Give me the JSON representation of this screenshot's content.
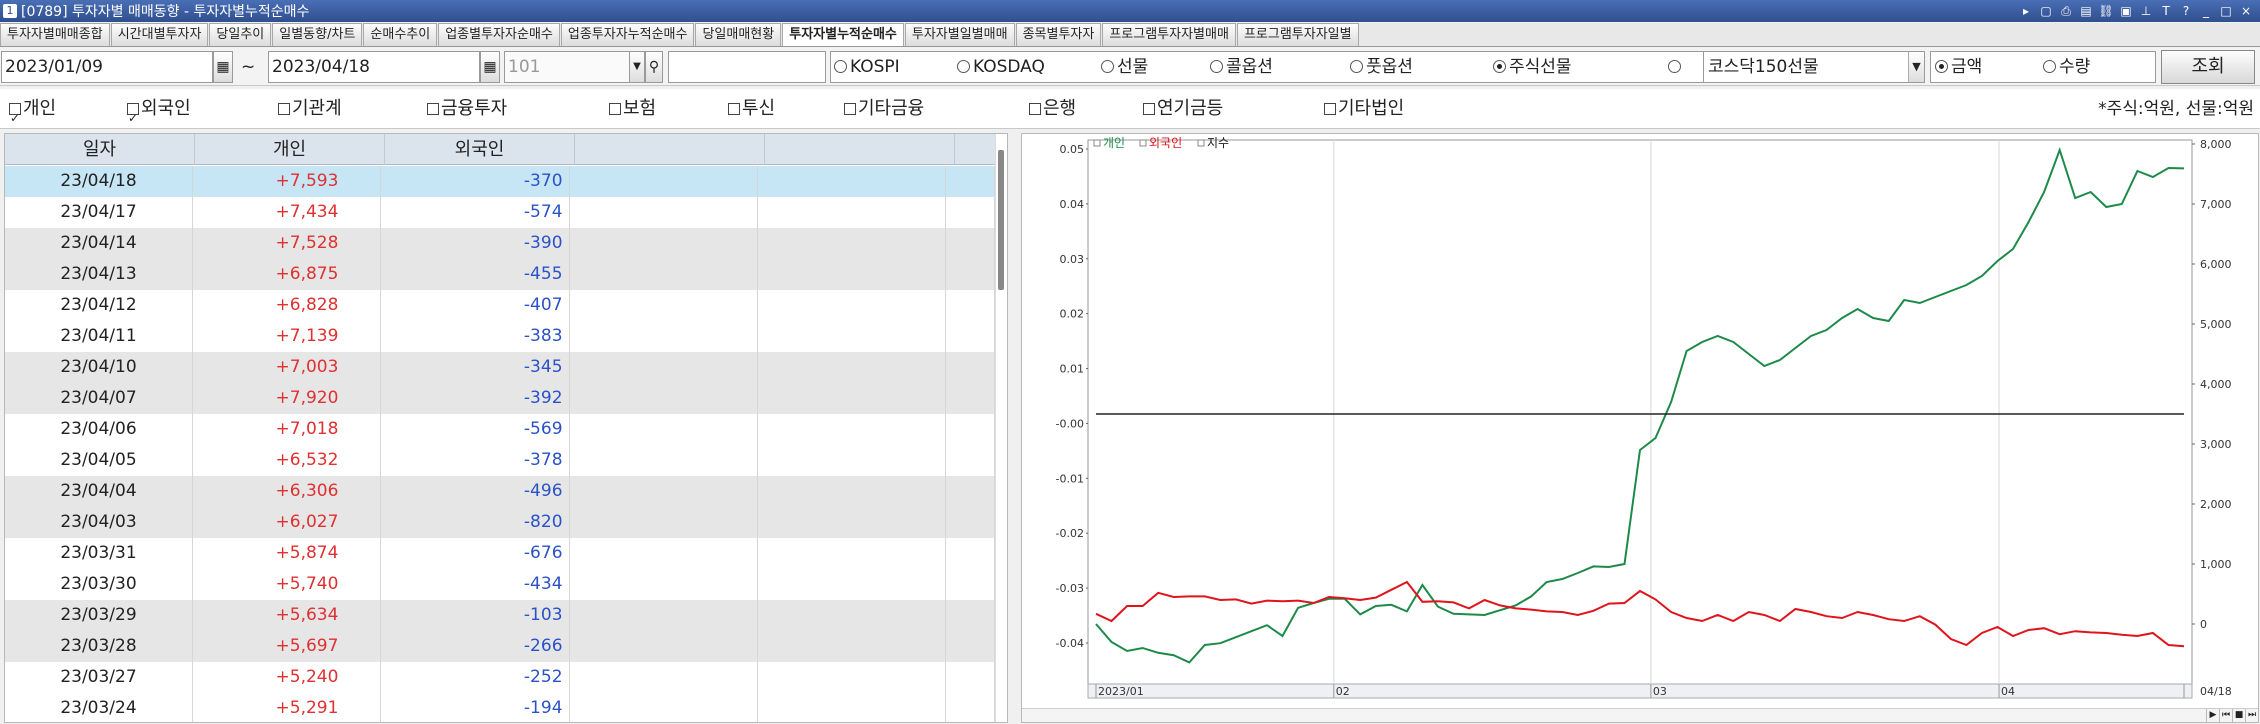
{
  "window": {
    "title": "[0789] 투자자별 매매동향 - 투자자별누적순매수",
    "icon_label": "1"
  },
  "tabs": [
    {
      "label": "투자자별매매종합",
      "active": false
    },
    {
      "label": "시간대별투자자",
      "active": false
    },
    {
      "label": "당일추이",
      "active": false
    },
    {
      "label": "일별동향/차트",
      "active": false
    },
    {
      "label": "순매수추이",
      "active": false
    },
    {
      "label": "업종별투자자순매수",
      "active": false
    },
    {
      "label": "업종투자자누적순매수",
      "active": false
    },
    {
      "label": "당일매매현황",
      "active": false
    },
    {
      "label": "투자자별누적순매수",
      "active": true
    },
    {
      "label": "투자자별일별매매",
      "active": false
    },
    {
      "label": "종목별투자자",
      "active": false
    },
    {
      "label": "프로그램투자자별매매",
      "active": false
    },
    {
      "label": "프로그램투자자일별",
      "active": false
    }
  ],
  "filters": {
    "start_date": "2023/01/09",
    "tilde": "~",
    "end_date": "2023/04/18",
    "code": "101",
    "markets": [
      {
        "label": "KOSPI",
        "checked": false
      },
      {
        "label": "KOSDAQ",
        "checked": false
      },
      {
        "label": "선물",
        "checked": false
      },
      {
        "label": "콜옵션",
        "checked": false
      },
      {
        "label": "풋옵션",
        "checked": false
      },
      {
        "label": "주식선물",
        "checked": true
      },
      {
        "label": "",
        "checked": false
      }
    ],
    "futures_select": "코스닥150선물",
    "units": [
      {
        "label": "금액",
        "checked": true
      },
      {
        "label": "수량",
        "checked": false
      }
    ],
    "query_button": "조회"
  },
  "investors": [
    {
      "label": "개인",
      "checked": true
    },
    {
      "label": "외국인",
      "checked": true
    },
    {
      "label": "기관계",
      "checked": false
    },
    {
      "label": "금융투자",
      "checked": false
    },
    {
      "label": "보험",
      "checked": false
    },
    {
      "label": "투신",
      "checked": false
    },
    {
      "label": "기타금융",
      "checked": false
    },
    {
      "label": "은행",
      "checked": false
    },
    {
      "label": "연기금등",
      "checked": false
    },
    {
      "label": "기타법인",
      "checked": false
    }
  ],
  "unit_note": "*주식:억원, 선물:억원",
  "grid": {
    "headers": [
      "일자",
      "개인",
      "외국인",
      "",
      "",
      ""
    ],
    "rows": [
      {
        "date": "23/04/18",
        "individual": "+7,593",
        "foreign": "-370"
      },
      {
        "date": "23/04/17",
        "individual": "+7,434",
        "foreign": "-574"
      },
      {
        "date": "23/04/14",
        "individual": "+7,528",
        "foreign": "-390"
      },
      {
        "date": "23/04/13",
        "individual": "+6,875",
        "foreign": "-455"
      },
      {
        "date": "23/04/12",
        "individual": "+6,828",
        "foreign": "-407"
      },
      {
        "date": "23/04/11",
        "individual": "+7,139",
        "foreign": "-383"
      },
      {
        "date": "23/04/10",
        "individual": "+7,003",
        "foreign": "-345"
      },
      {
        "date": "23/04/07",
        "individual": "+7,920",
        "foreign": "-392"
      },
      {
        "date": "23/04/06",
        "individual": "+7,018",
        "foreign": "-569"
      },
      {
        "date": "23/04/05",
        "individual": "+6,532",
        "foreign": "-378"
      },
      {
        "date": "23/04/04",
        "individual": "+6,306",
        "foreign": "-496"
      },
      {
        "date": "23/04/03",
        "individual": "+6,027",
        "foreign": "-820"
      },
      {
        "date": "23/03/31",
        "individual": "+5,874",
        "foreign": "-676"
      },
      {
        "date": "23/03/30",
        "individual": "+5,740",
        "foreign": "-434"
      },
      {
        "date": "23/03/29",
        "individual": "+5,634",
        "foreign": "-103"
      },
      {
        "date": "23/03/28",
        "individual": "+5,697",
        "foreign": "-266"
      },
      {
        "date": "23/03/27",
        "individual": "+5,240",
        "foreign": "-252"
      },
      {
        "date": "23/03/24",
        "individual": "+5,291",
        "foreign": "-194"
      }
    ]
  },
  "chart_data": {
    "type": "line",
    "legend": [
      "개인",
      "외국인",
      "지수"
    ],
    "colors": {
      "개인": "#1e8a4a",
      "외국인": "#e0141c",
      "지수": "#222222"
    },
    "left_axis": {
      "ticks": [
        "0.05",
        "0.04",
        "0.03",
        "0.02",
        "0.01",
        "-0.00",
        "-0.01",
        "-0.02",
        "-0.03",
        "-0.04"
      ],
      "range": [
        -0.045,
        0.05
      ]
    },
    "right_axis": {
      "ticks": [
        "8,000",
        "7,000",
        "6,000",
        "5,000",
        "4,000",
        "3,000",
        "2,000",
        "1,000",
        "0"
      ],
      "range": [
        -1000,
        8000
      ]
    },
    "x_labels": [
      "2023/01",
      "02",
      "03",
      "04",
      "04/18"
    ],
    "x_label_positions": [
      0,
      15.3,
      35.7,
      58.1,
      70
    ],
    "n_points": 71,
    "series": [
      {
        "name": "개인",
        "values": [
          0,
          -300,
          -450,
          -400,
          -480,
          -520,
          -640,
          -350,
          -320,
          -220,
          -120,
          -20,
          -200,
          270,
          350,
          420,
          420,
          160,
          300,
          320,
          210,
          650,
          290,
          170,
          160,
          150,
          230,
          310,
          460,
          700,
          750,
          850,
          960,
          950,
          1000,
          2900,
          3100,
          3700,
          4550,
          4700,
          4800,
          4700,
          4500,
          4300,
          4400,
          4600,
          4800,
          4900,
          5100,
          5250,
          5100,
          5050,
          5400,
          5350,
          5450,
          5550,
          5650,
          5800,
          6050,
          6250,
          6700,
          7200,
          7900,
          7100,
          7200,
          6950,
          7000,
          7550,
          7450,
          7600,
          7593
        ]
      },
      {
        "name": "외국인",
        "values": [
          170,
          50,
          300,
          300,
          520,
          450,
          460,
          460,
          400,
          410,
          340,
          390,
          380,
          390,
          350,
          450,
          430,
          400,
          440,
          570,
          700,
          370,
          380,
          360,
          260,
          400,
          310,
          260,
          240,
          210,
          200,
          150,
          220,
          340,
          350,
          550,
          410,
          200,
          100,
          50,
          150,
          50,
          200,
          150,
          50,
          250,
          200,
          130,
          100,
          200,
          150,
          80,
          50,
          130,
          -10,
          -250,
          -350,
          -150,
          -50,
          -200,
          -100,
          -70,
          -170,
          -120,
          -140,
          -150,
          -180,
          -200,
          -150,
          -350,
          -370
        ]
      },
      {
        "name": "지수",
        "values": [
          3500,
          3500
        ]
      }
    ]
  }
}
